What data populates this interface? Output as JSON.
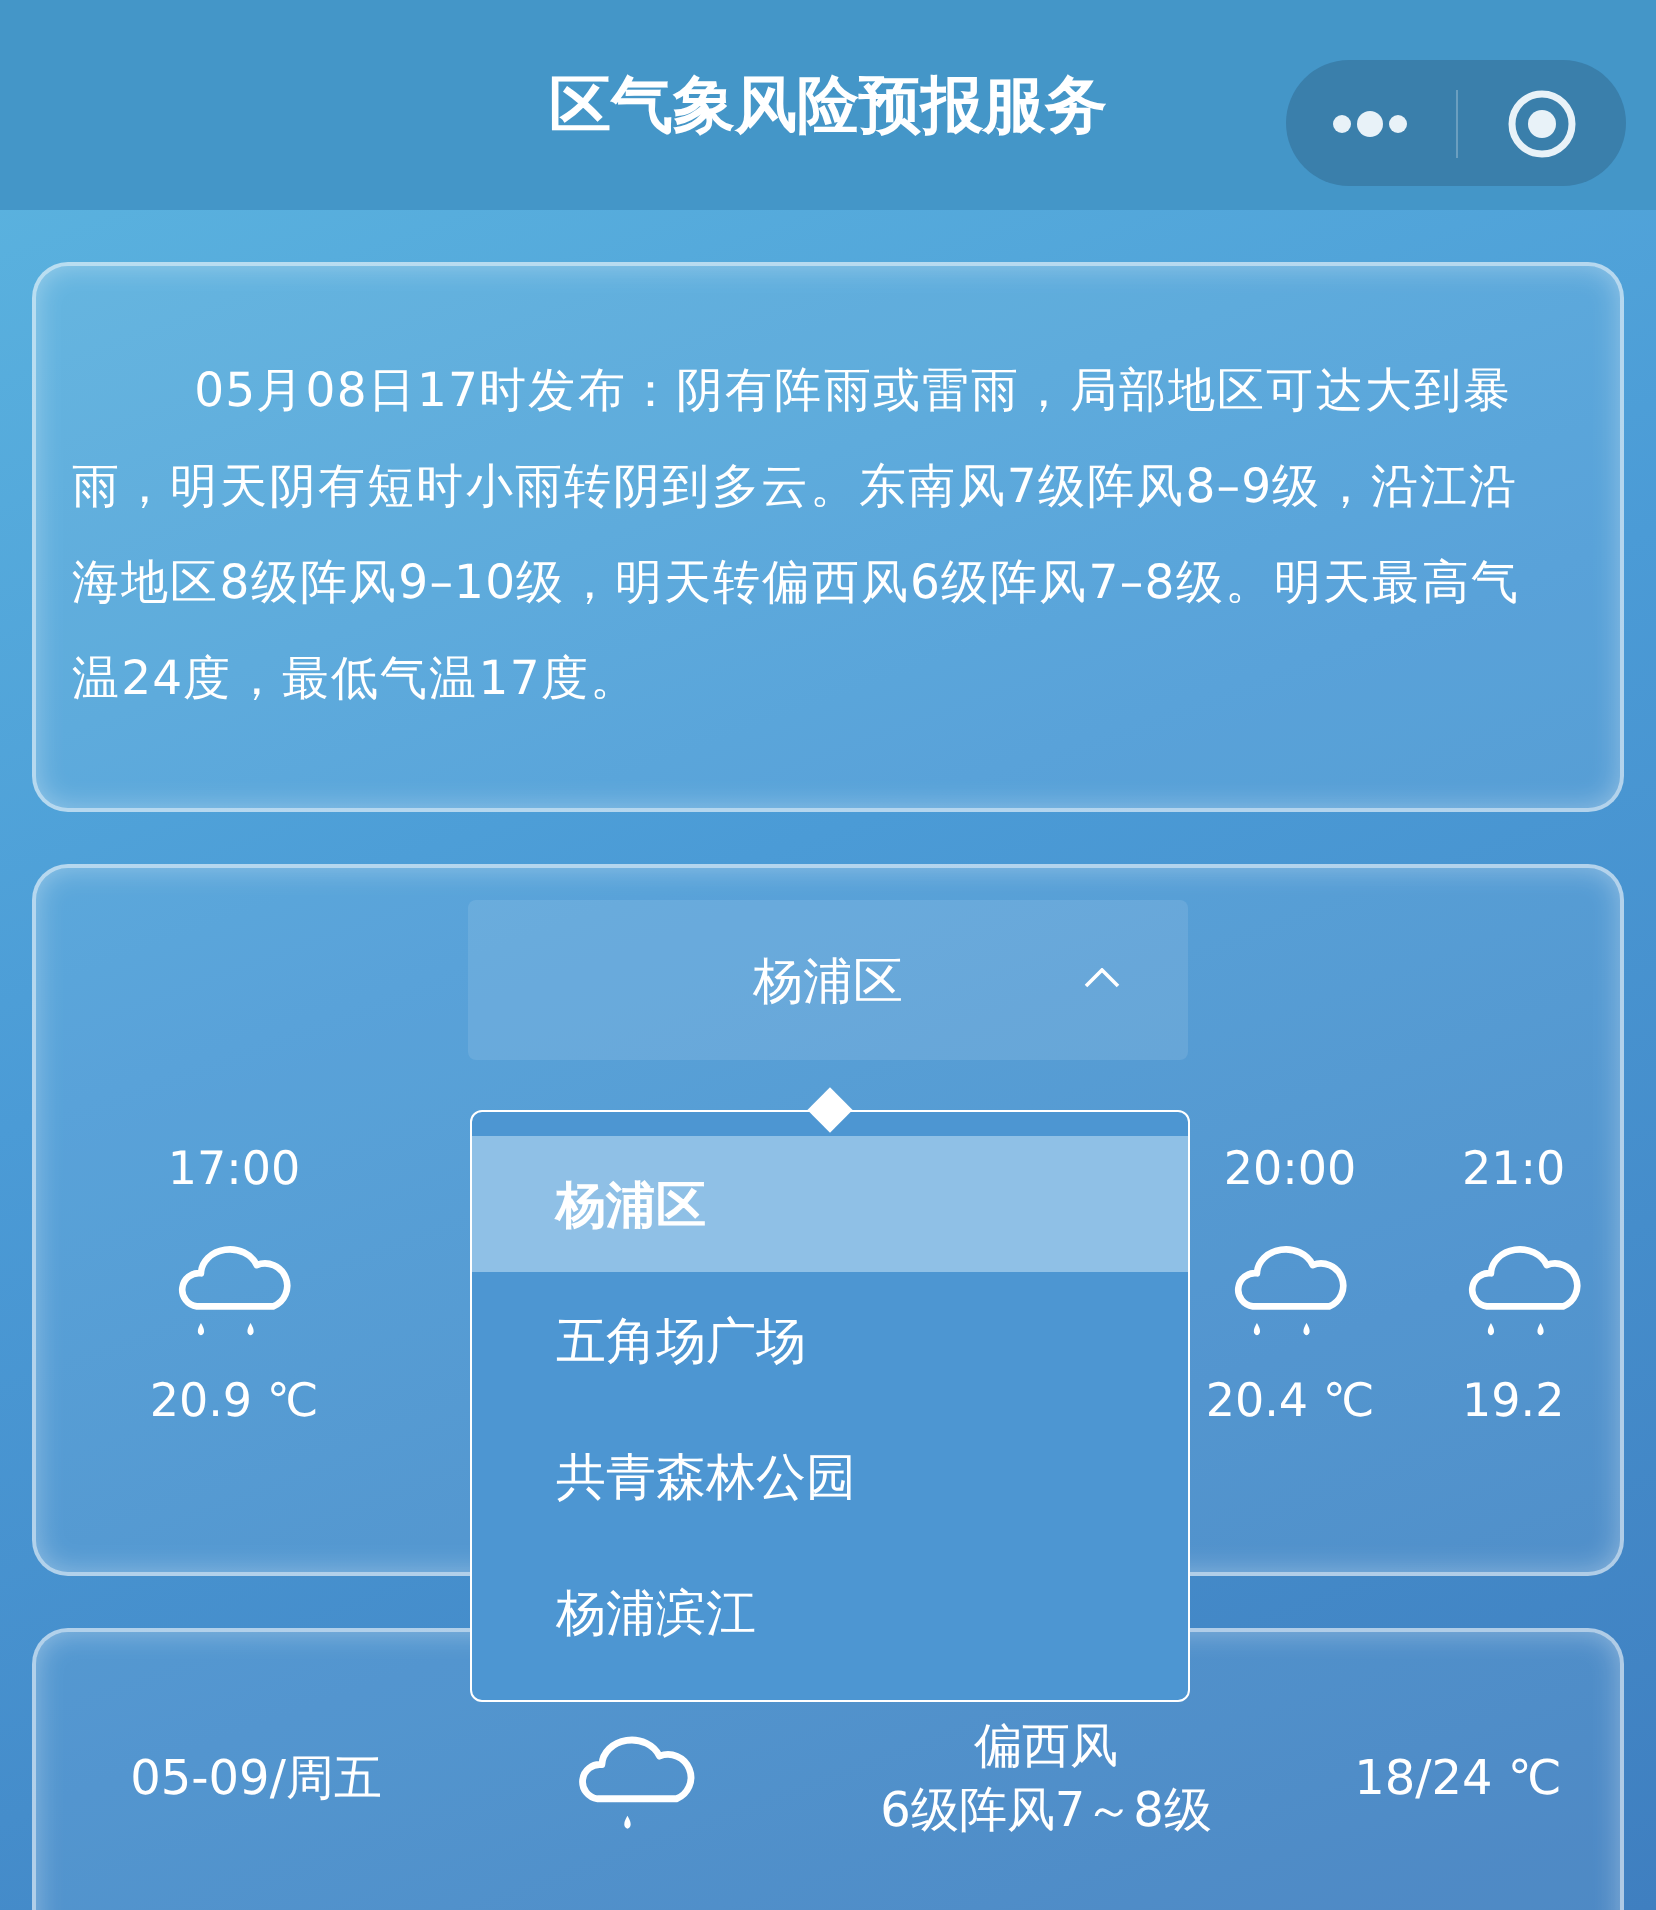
{
  "header": {
    "title": "区气象风险预报服务"
  },
  "notice": {
    "text": "05月08日17时发布：阴有阵雨或雷雨，局部地区可达大到暴雨，明天阴有短时小雨转阴到多云。东南风7级阵风8–9级，沿江沿海地区8级阵风9–10级，明天转偏西风6级阵风7–8级。明天最高气温24度，最低气温17度。"
  },
  "district": {
    "value": "杨浦区",
    "expanded": true,
    "options": [
      {
        "label": "杨浦区",
        "selected": true
      },
      {
        "label": "五角场广场",
        "selected": false
      },
      {
        "label": "共青森林公园",
        "selected": false
      },
      {
        "label": "杨浦滨江",
        "selected": false
      }
    ]
  },
  "hourly": [
    {
      "time": "17:00",
      "kind": "rain",
      "temp": "20.9 ℃"
    },
    {
      "time": "20:00",
      "kind": "rain",
      "temp": "20.4 ℃"
    },
    {
      "time": "21:0",
      "kind": "rain",
      "temp": "19.2"
    }
  ],
  "daily": [
    {
      "date": "05-09/周五",
      "kind": "light-rain",
      "wind": "偏西风",
      "gust": "6级阵风7～8级",
      "temp": "18/24 ℃"
    }
  ]
}
